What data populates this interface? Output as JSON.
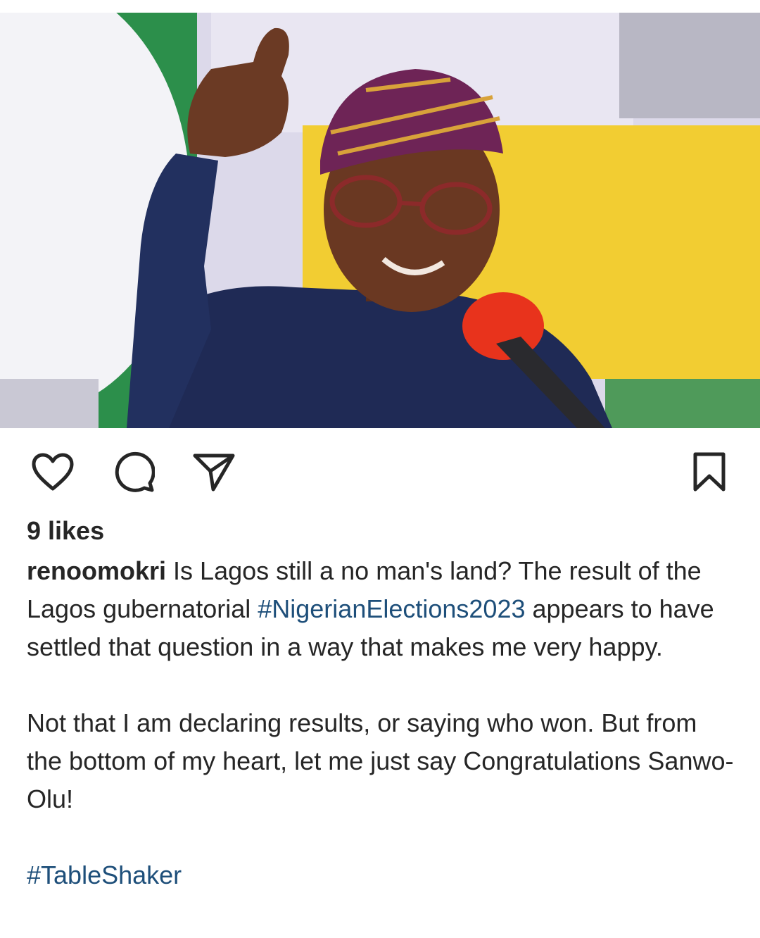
{
  "post": {
    "image_alt": "Man in dark blue attire and purple patterned cap giving a thumbs up at a red microphone",
    "likes_text": "9 likes",
    "username": "renoomokri",
    "caption": {
      "line1_text": " Is Lagos still a no man's land? The result of the Lagos gubernatorial ",
      "hashtag_elections": "#NigerianElections2023",
      "line1_tail": " appears to have settled that question in a way that makes me very happy.",
      "paragraph2": "Not that I am declaring results, or saying who won. But from the bottom of my heart, let me just say Congratulations Sanwo-Olu!",
      "hashtag_tableshaker": "#TableShaker"
    }
  },
  "actions": {
    "like_icon": "heart-outline-icon",
    "comment_icon": "speech-bubble-icon",
    "share_icon": "paper-plane-icon",
    "save_icon": "bookmark-outline-icon"
  },
  "colors": {
    "text": "#262626",
    "hashtag": "#1e4f7a",
    "background": "#ffffff"
  }
}
